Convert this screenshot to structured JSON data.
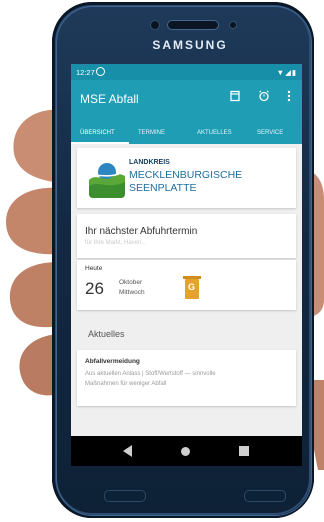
{
  "device": {
    "brand": "SAMSUNG"
  },
  "status_bar": {
    "time": "12:27",
    "icons": "▼◢▮"
  },
  "app_bar": {
    "title": "MSE Abfall",
    "icons": [
      "calendar-icon",
      "alarm-icon",
      "more-vert-icon"
    ]
  },
  "tabs": [
    {
      "label": "ÜBERSICHT",
      "active": true
    },
    {
      "label": "TERMINE",
      "active": false
    },
    {
      "label": "AKTUELLES",
      "active": false
    },
    {
      "label": "SERVICE",
      "active": false
    }
  ],
  "logo": {
    "line1": "LANDKREIS",
    "line2": "MECKLENBURGISCHE",
    "line3": "SEENPLATTE"
  },
  "next_pickup": {
    "title": "Ihr nächster Abfuhrtermin",
    "subtitle": "für Ihre Markt, Haven..."
  },
  "date_entry": {
    "heading": "Heute",
    "day": "26",
    "month": "Oktober",
    "weekday": "Mittwoch",
    "bin_label": "G"
  },
  "news": {
    "section_title": "Aktuelles",
    "headline": "Abfallvermeidung",
    "text_line1": "Aus aktuellen Anlass | Stoff/Wertstoff — sinnvolle",
    "text_line2": "Maßnahmen für weniger Abfall"
  },
  "colors": {
    "app_bar": "#1f9db5",
    "status_bar": "#178fa9",
    "bin": "#e4a32d",
    "phone_body": "#132942"
  }
}
